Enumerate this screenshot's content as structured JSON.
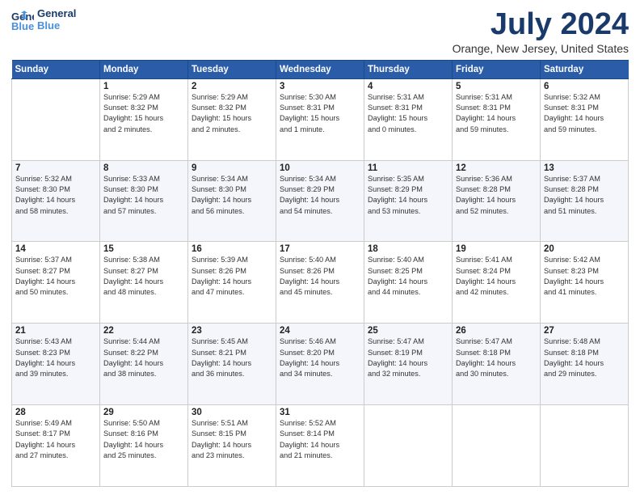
{
  "header": {
    "logo_line1": "General",
    "logo_line2": "Blue",
    "month": "July 2024",
    "location": "Orange, New Jersey, United States"
  },
  "weekdays": [
    "Sunday",
    "Monday",
    "Tuesday",
    "Wednesday",
    "Thursday",
    "Friday",
    "Saturday"
  ],
  "weeks": [
    [
      {
        "num": "",
        "info": ""
      },
      {
        "num": "1",
        "info": "Sunrise: 5:29 AM\nSunset: 8:32 PM\nDaylight: 15 hours\nand 2 minutes."
      },
      {
        "num": "2",
        "info": "Sunrise: 5:29 AM\nSunset: 8:32 PM\nDaylight: 15 hours\nand 2 minutes."
      },
      {
        "num": "3",
        "info": "Sunrise: 5:30 AM\nSunset: 8:31 PM\nDaylight: 15 hours\nand 1 minute."
      },
      {
        "num": "4",
        "info": "Sunrise: 5:31 AM\nSunset: 8:31 PM\nDaylight: 15 hours\nand 0 minutes."
      },
      {
        "num": "5",
        "info": "Sunrise: 5:31 AM\nSunset: 8:31 PM\nDaylight: 14 hours\nand 59 minutes."
      },
      {
        "num": "6",
        "info": "Sunrise: 5:32 AM\nSunset: 8:31 PM\nDaylight: 14 hours\nand 59 minutes."
      }
    ],
    [
      {
        "num": "7",
        "info": "Sunrise: 5:32 AM\nSunset: 8:30 PM\nDaylight: 14 hours\nand 58 minutes."
      },
      {
        "num": "8",
        "info": "Sunrise: 5:33 AM\nSunset: 8:30 PM\nDaylight: 14 hours\nand 57 minutes."
      },
      {
        "num": "9",
        "info": "Sunrise: 5:34 AM\nSunset: 8:30 PM\nDaylight: 14 hours\nand 56 minutes."
      },
      {
        "num": "10",
        "info": "Sunrise: 5:34 AM\nSunset: 8:29 PM\nDaylight: 14 hours\nand 54 minutes."
      },
      {
        "num": "11",
        "info": "Sunrise: 5:35 AM\nSunset: 8:29 PM\nDaylight: 14 hours\nand 53 minutes."
      },
      {
        "num": "12",
        "info": "Sunrise: 5:36 AM\nSunset: 8:28 PM\nDaylight: 14 hours\nand 52 minutes."
      },
      {
        "num": "13",
        "info": "Sunrise: 5:37 AM\nSunset: 8:28 PM\nDaylight: 14 hours\nand 51 minutes."
      }
    ],
    [
      {
        "num": "14",
        "info": "Sunrise: 5:37 AM\nSunset: 8:27 PM\nDaylight: 14 hours\nand 50 minutes."
      },
      {
        "num": "15",
        "info": "Sunrise: 5:38 AM\nSunset: 8:27 PM\nDaylight: 14 hours\nand 48 minutes."
      },
      {
        "num": "16",
        "info": "Sunrise: 5:39 AM\nSunset: 8:26 PM\nDaylight: 14 hours\nand 47 minutes."
      },
      {
        "num": "17",
        "info": "Sunrise: 5:40 AM\nSunset: 8:26 PM\nDaylight: 14 hours\nand 45 minutes."
      },
      {
        "num": "18",
        "info": "Sunrise: 5:40 AM\nSunset: 8:25 PM\nDaylight: 14 hours\nand 44 minutes."
      },
      {
        "num": "19",
        "info": "Sunrise: 5:41 AM\nSunset: 8:24 PM\nDaylight: 14 hours\nand 42 minutes."
      },
      {
        "num": "20",
        "info": "Sunrise: 5:42 AM\nSunset: 8:23 PM\nDaylight: 14 hours\nand 41 minutes."
      }
    ],
    [
      {
        "num": "21",
        "info": "Sunrise: 5:43 AM\nSunset: 8:23 PM\nDaylight: 14 hours\nand 39 minutes."
      },
      {
        "num": "22",
        "info": "Sunrise: 5:44 AM\nSunset: 8:22 PM\nDaylight: 14 hours\nand 38 minutes."
      },
      {
        "num": "23",
        "info": "Sunrise: 5:45 AM\nSunset: 8:21 PM\nDaylight: 14 hours\nand 36 minutes."
      },
      {
        "num": "24",
        "info": "Sunrise: 5:46 AM\nSunset: 8:20 PM\nDaylight: 14 hours\nand 34 minutes."
      },
      {
        "num": "25",
        "info": "Sunrise: 5:47 AM\nSunset: 8:19 PM\nDaylight: 14 hours\nand 32 minutes."
      },
      {
        "num": "26",
        "info": "Sunrise: 5:47 AM\nSunset: 8:18 PM\nDaylight: 14 hours\nand 30 minutes."
      },
      {
        "num": "27",
        "info": "Sunrise: 5:48 AM\nSunset: 8:18 PM\nDaylight: 14 hours\nand 29 minutes."
      }
    ],
    [
      {
        "num": "28",
        "info": "Sunrise: 5:49 AM\nSunset: 8:17 PM\nDaylight: 14 hours\nand 27 minutes."
      },
      {
        "num": "29",
        "info": "Sunrise: 5:50 AM\nSunset: 8:16 PM\nDaylight: 14 hours\nand 25 minutes."
      },
      {
        "num": "30",
        "info": "Sunrise: 5:51 AM\nSunset: 8:15 PM\nDaylight: 14 hours\nand 23 minutes."
      },
      {
        "num": "31",
        "info": "Sunrise: 5:52 AM\nSunset: 8:14 PM\nDaylight: 14 hours\nand 21 minutes."
      },
      {
        "num": "",
        "info": ""
      },
      {
        "num": "",
        "info": ""
      },
      {
        "num": "",
        "info": ""
      }
    ]
  ]
}
